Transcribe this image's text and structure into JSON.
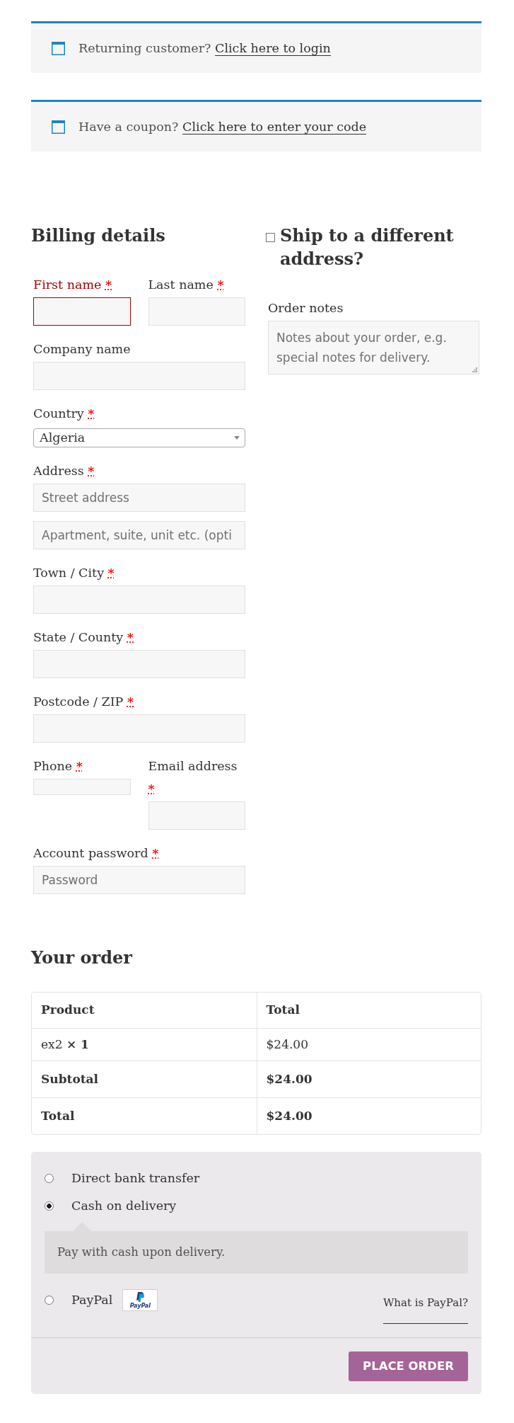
{
  "notices": [
    {
      "text": "Returning customer?",
      "link": "Click here to login"
    },
    {
      "text": "Have a coupon?",
      "link": "Click here to enter your code"
    }
  ],
  "billing": {
    "title": "Billing details",
    "rows": [
      {
        "fields": [
          {
            "label": "First name",
            "required_mark": "*",
            "kind": "text",
            "invalid": true
          },
          {
            "label": "Last name",
            "required_mark": "*",
            "kind": "text",
            "invalid": false
          }
        ]
      },
      {
        "fields": [
          {
            "label": "Company name",
            "kind": "text",
            "invalid": false
          }
        ]
      },
      {
        "fields": [
          {
            "label": "Country",
            "required_mark": "*",
            "kind": "select",
            "value": "Algeria",
            "invalid": false
          }
        ]
      },
      {
        "fields": [
          {
            "label": "Address",
            "required_mark": "*",
            "kind": "text",
            "placeholder": "Street address",
            "invalid": false
          }
        ]
      },
      {
        "fields": [
          {
            "kind": "text",
            "placeholder": "Apartment, suite, unit etc. (opti",
            "invalid": false
          }
        ]
      },
      {
        "fields": [
          {
            "label": "Town / City",
            "required_mark": "*",
            "kind": "text",
            "invalid": false
          }
        ]
      },
      {
        "fields": [
          {
            "label": "State / County",
            "required_mark": "*",
            "kind": "text",
            "invalid": false
          }
        ]
      },
      {
        "fields": [
          {
            "label": "Postcode / ZIP",
            "required_mark": "*",
            "kind": "text",
            "invalid": false
          }
        ]
      },
      {
        "fields": [
          {
            "label": "Phone",
            "required_mark": "*",
            "kind": "tel",
            "invalid": false
          },
          {
            "label": "Email address",
            "required_mark": "*",
            "kind": "email",
            "invalid": false
          }
        ]
      },
      {
        "fields": [
          {
            "label": "Account password",
            "required_mark": "*",
            "kind": "password",
            "placeholder": "Password",
            "invalid": false
          }
        ]
      }
    ]
  },
  "shipping": {
    "checked": false,
    "title": "Ship to a different address?"
  },
  "order_notes": {
    "label": "Order notes",
    "placeholder": "Notes about your order, e.g. special notes for delivery."
  },
  "order": {
    "title": "Your order",
    "columns": [
      "Product",
      "Total"
    ],
    "rows": [
      {
        "kind": "item",
        "cells": [
          "ex2 **× 1**",
          "$24.00"
        ]
      },
      {
        "kind": "total",
        "cells": [
          "Subtotal",
          "$24.00"
        ]
      },
      {
        "kind": "total",
        "cells": [
          "Total",
          "$24.00"
        ]
      }
    ]
  },
  "payment": {
    "methods": [
      {
        "label": "Direct bank transfer",
        "selected": false
      },
      {
        "label": "Cash on delivery",
        "selected": true,
        "description": "Pay with cash upon delivery."
      },
      {
        "label": "PayPal",
        "selected": false,
        "logo_text": "PayPal",
        "link": "What is PayPal?"
      }
    ],
    "button": "PLACE ORDER"
  }
}
